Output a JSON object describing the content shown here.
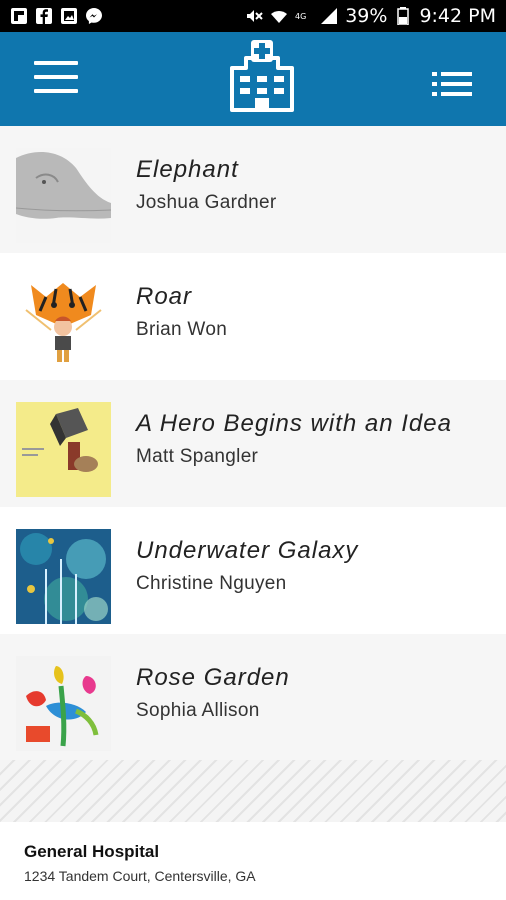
{
  "status_bar": {
    "battery": "39%",
    "time": "9:42 PM",
    "left_icons": [
      "flipboard-icon",
      "facebook-icon",
      "gallery-icon",
      "messenger-icon"
    ],
    "right_icons": [
      "mute-icon",
      "wifi-icon",
      "lte-icon",
      "signal-icon",
      "battery-icon"
    ]
  },
  "header": {
    "menu_icon": "hamburger-menu-icon",
    "logo_icon": "hospital-icon",
    "list_icon": "list-view-icon",
    "color": "#0f76ae"
  },
  "artworks": [
    {
      "title": "Elephant",
      "artist": "Joshua Gardner"
    },
    {
      "title": "Roar",
      "artist": "Brian Won"
    },
    {
      "title": "A Hero Begins with an Idea",
      "artist": "Matt Spangler"
    },
    {
      "title": "Underwater Galaxy",
      "artist": "Christine Nguyen"
    },
    {
      "title": "Rose Garden",
      "artist": "Sophia Allison"
    }
  ],
  "footer": {
    "name": "General Hospital",
    "address": "1234 Tandem Court, Centersville, GA"
  }
}
